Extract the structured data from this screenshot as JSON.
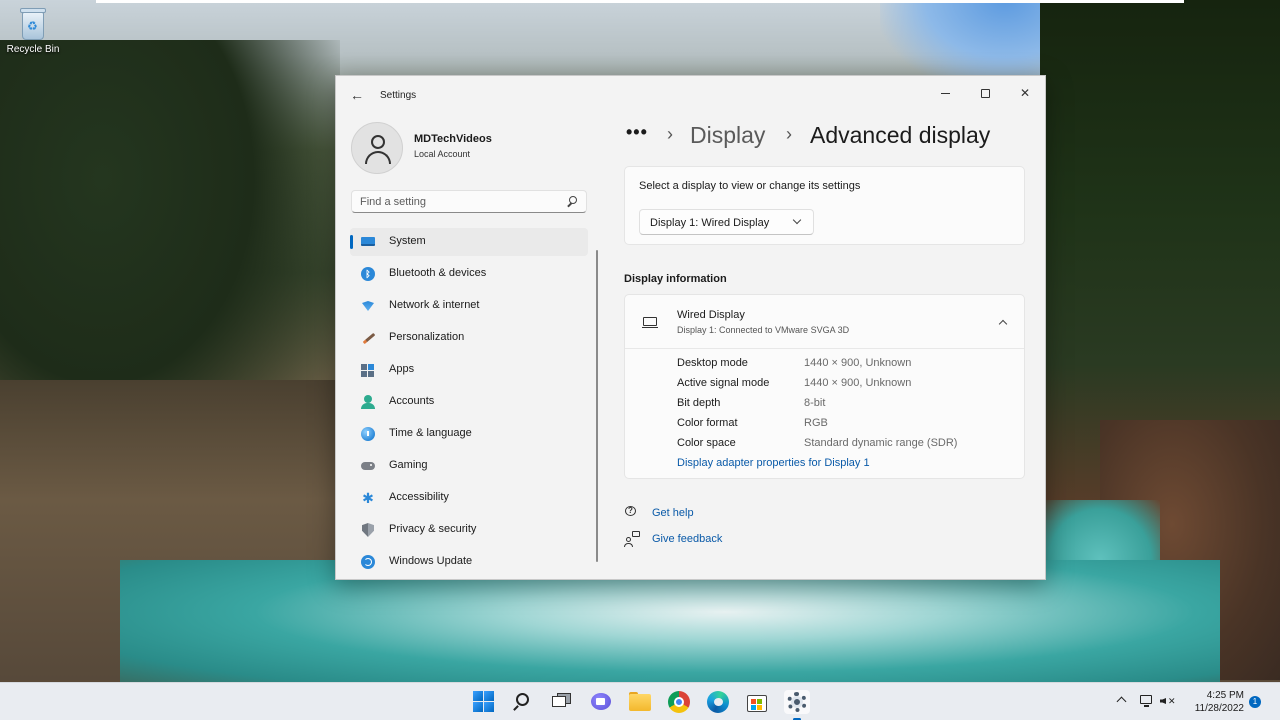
{
  "desktop": {
    "icons": [
      {
        "label": "Recycle Bin",
        "icon": "recycle-bin-icon"
      }
    ]
  },
  "window": {
    "app_title": "Settings",
    "controls": {
      "minimize": "minimize-icon",
      "maximize": "maximize-icon",
      "close": "close-icon"
    }
  },
  "profile": {
    "name": "MDTechVideos",
    "account_type": "Local Account"
  },
  "search": {
    "placeholder": "Find a setting",
    "value": ""
  },
  "sidebar": {
    "items": [
      {
        "label": "System",
        "icon": "system-icon",
        "active": true
      },
      {
        "label": "Bluetooth & devices",
        "icon": "bluetooth-icon"
      },
      {
        "label": "Network & internet",
        "icon": "network-icon"
      },
      {
        "label": "Personalization",
        "icon": "personalization-icon"
      },
      {
        "label": "Apps",
        "icon": "apps-icon"
      },
      {
        "label": "Accounts",
        "icon": "accounts-icon"
      },
      {
        "label": "Time & language",
        "icon": "time-language-icon"
      },
      {
        "label": "Gaming",
        "icon": "gaming-icon"
      },
      {
        "label": "Accessibility",
        "icon": "accessibility-icon"
      },
      {
        "label": "Privacy & security",
        "icon": "privacy-icon"
      },
      {
        "label": "Windows Update",
        "icon": "windows-update-icon"
      }
    ]
  },
  "breadcrumb": {
    "overflow": "•••",
    "parent": "Display",
    "current": "Advanced display"
  },
  "display_select": {
    "prompt": "Select a display to view or change its settings",
    "selected": "Display 1: Wired Display"
  },
  "display_info": {
    "section_title": "Display information",
    "title": "Wired Display",
    "subtitle": "Display 1: Connected to VMware SVGA 3D",
    "rows": [
      {
        "key": "Desktop mode",
        "value": "1440 × 900, Unknown"
      },
      {
        "key": "Active signal mode",
        "value": "1440 × 900, Unknown"
      },
      {
        "key": "Bit depth",
        "value": "8-bit"
      },
      {
        "key": "Color format",
        "value": "RGB"
      },
      {
        "key": "Color space",
        "value": "Standard dynamic range (SDR)"
      }
    ],
    "link": "Display adapter properties for Display 1"
  },
  "help": {
    "get_help": "Get help",
    "give_feedback": "Give feedback"
  },
  "taskbar": {
    "apps": [
      "start",
      "search",
      "task-view",
      "chat",
      "file-explorer",
      "chrome",
      "edge",
      "microsoft-store",
      "settings"
    ],
    "time": "4:25 PM",
    "date": "11/28/2022",
    "notification_count": "1"
  },
  "colors": {
    "accent": "#0067c0",
    "link": "#0a5aa8",
    "window_bg": "#f3f3f3",
    "card_bg": "#fbfbfb"
  }
}
